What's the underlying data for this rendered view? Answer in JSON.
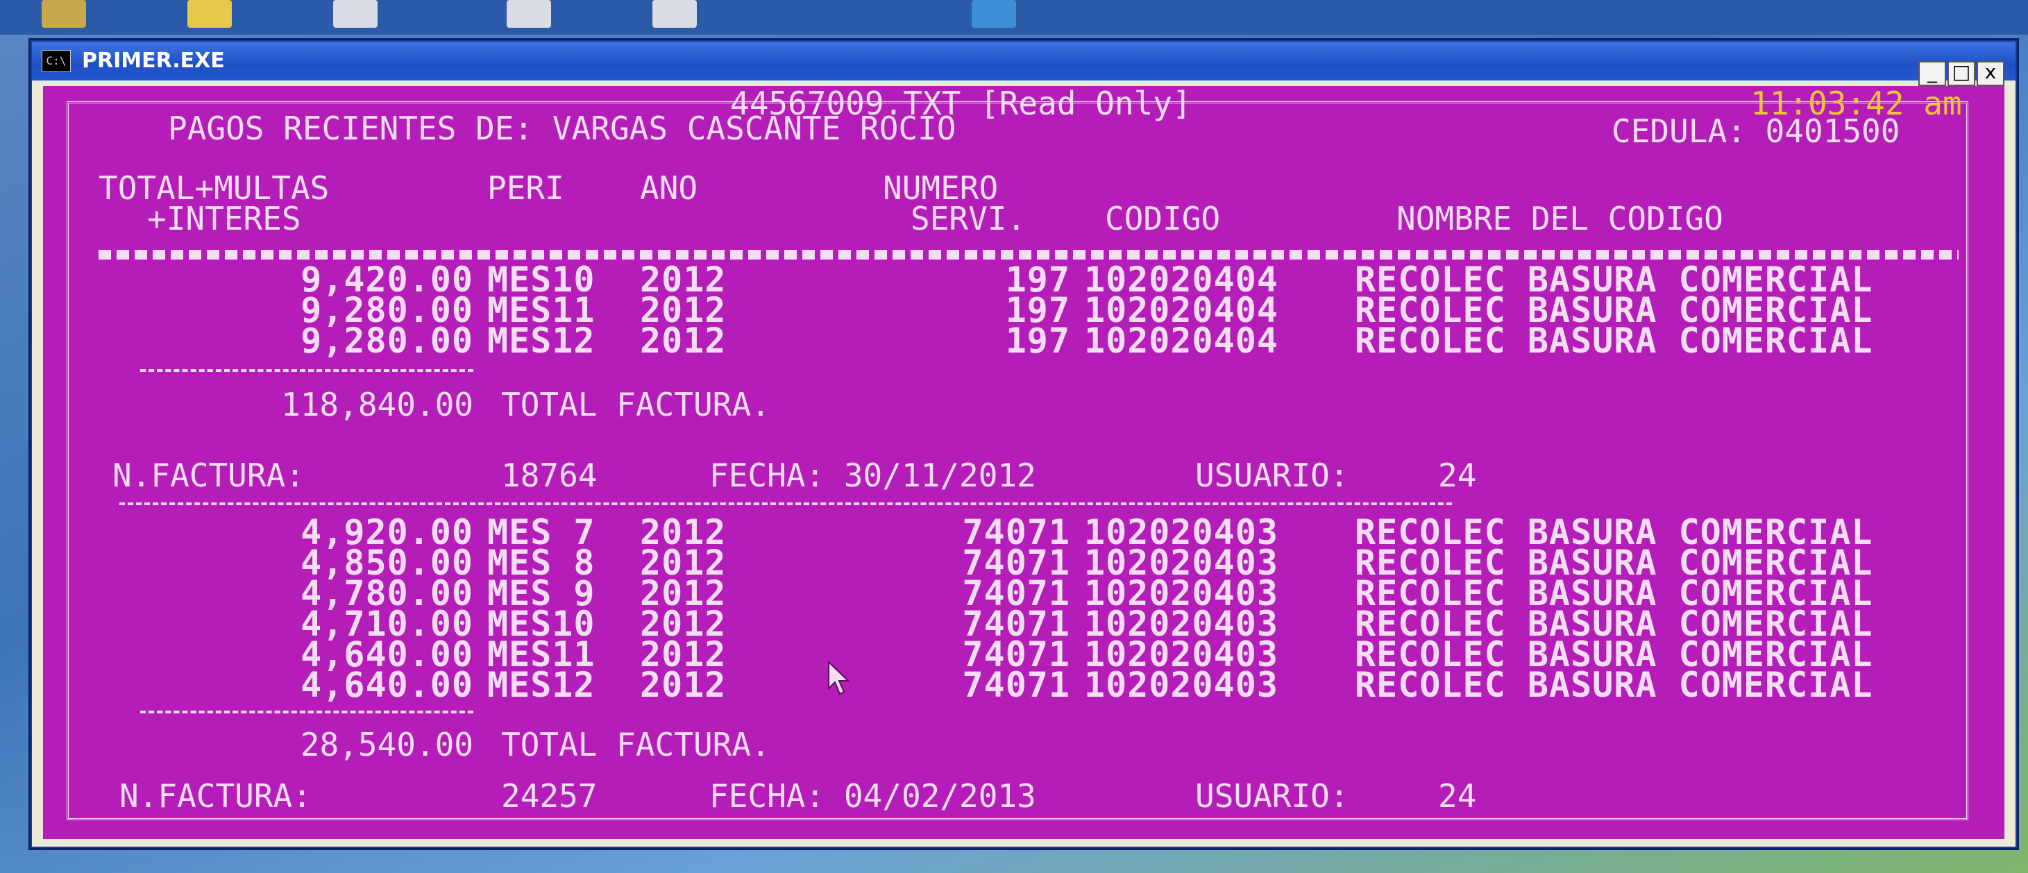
{
  "window": {
    "title": "PRIMER.EXE",
    "icon_text": "C:\\",
    "minimize": "_",
    "maximize": "□",
    "close": "x"
  },
  "console": {
    "file_banner": "44567009.TXT [Read Only]",
    "clock": "11:03:42 am",
    "header_title": "PAGOS RECIENTES DE: VARGAS CASCANTE ROCIO",
    "cedula": "CEDULA: 0401500",
    "columns": {
      "total_1": "TOTAL+MULTAS",
      "total_2": "+INTERES",
      "peri": "PERI",
      "ano": "ANO",
      "numero_1": "NUMERO",
      "numero_2": "SERVI.",
      "codigo": "CODIGO",
      "nombre": "NOMBRE DEL CODIGO"
    },
    "invoices": [
      {
        "rows": [
          {
            "total": "9,420.00",
            "peri": "MES10",
            "ano": "2012",
            "servi": "197",
            "codigo": "102020404",
            "nombre": "RECOLEC BASURA COMERCIAL"
          },
          {
            "total": "9,280.00",
            "peri": "MES11",
            "ano": "2012",
            "servi": "197",
            "codigo": "102020404",
            "nombre": "RECOLEC BASURA COMERCIAL"
          },
          {
            "total": "9,280.00",
            "peri": "MES12",
            "ano": "2012",
            "servi": "197",
            "codigo": "102020404",
            "nombre": "RECOLEC BASURA COMERCIAL"
          }
        ],
        "total": "118,840.00",
        "total_label": "TOTAL FACTURA.",
        "factura_label": "N.FACTURA:",
        "factura": "18764",
        "fecha": "FECHA: 30/11/2012",
        "usuario_label": "USUARIO:",
        "usuario": "24"
      },
      {
        "rows": [
          {
            "total": "4,920.00",
            "peri": "MES 7",
            "ano": "2012",
            "servi": "74071",
            "codigo": "102020403",
            "nombre": "RECOLEC BASURA COMERCIAL"
          },
          {
            "total": "4,850.00",
            "peri": "MES 8",
            "ano": "2012",
            "servi": "74071",
            "codigo": "102020403",
            "nombre": "RECOLEC BASURA COMERCIAL"
          },
          {
            "total": "4,780.00",
            "peri": "MES 9",
            "ano": "2012",
            "servi": "74071",
            "codigo": "102020403",
            "nombre": "RECOLEC BASURA COMERCIAL"
          },
          {
            "total": "4,710.00",
            "peri": "MES10",
            "ano": "2012",
            "servi": "74071",
            "codigo": "102020403",
            "nombre": "RECOLEC BASURA COMERCIAL"
          },
          {
            "total": "4,640.00",
            "peri": "MES11",
            "ano": "2012",
            "servi": "74071",
            "codigo": "102020403",
            "nombre": "RECOLEC BASURA COMERCIAL"
          },
          {
            "total": "4,640.00",
            "peri": "MES12",
            "ano": "2012",
            "servi": "74071",
            "codigo": "102020403",
            "nombre": "RECOLEC BASURA COMERCIAL"
          }
        ],
        "total": "28,540.00",
        "total_label": "TOTAL FACTURA.",
        "factura_label": "N.FACTURA:",
        "factura": "24257",
        "fecha": "FECHA: 04/02/2013",
        "usuario_label": "USUARIO:",
        "usuario": "24"
      }
    ]
  },
  "colors": {
    "console_bg": "#b51db8",
    "console_fg": "#f6ddf6",
    "clock": "#f2c23a",
    "titlebar": "#1e4fc5"
  }
}
